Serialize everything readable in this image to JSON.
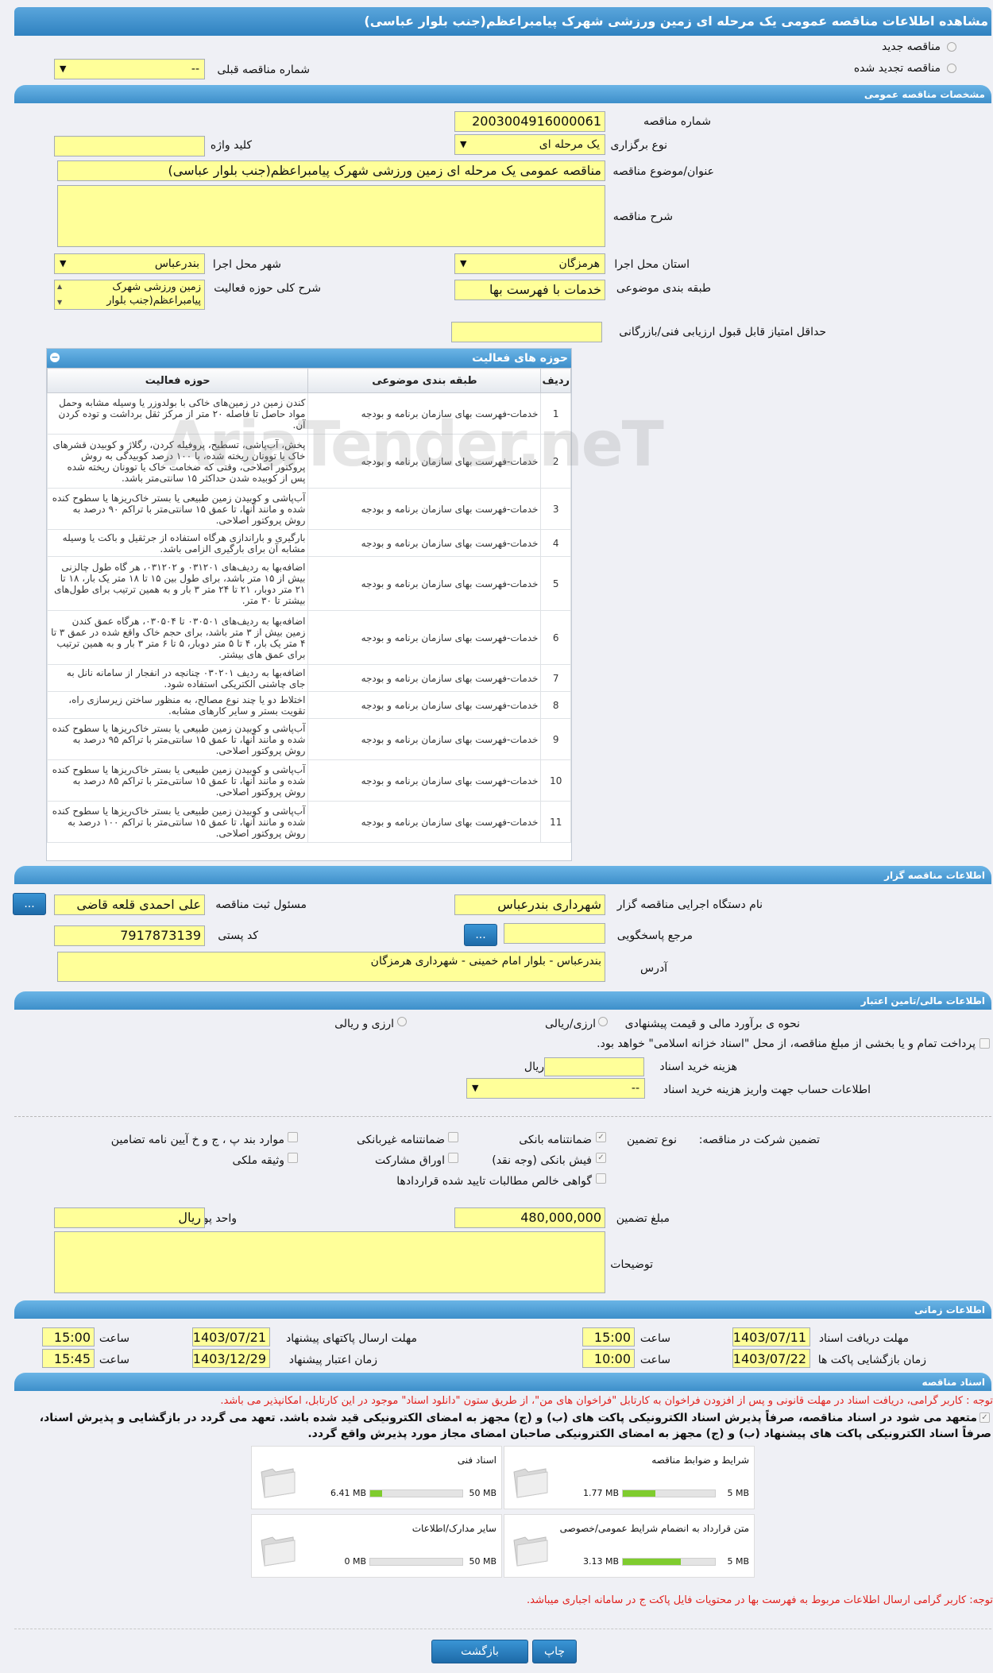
{
  "title": "مشاهده اطلاعات مناقصه عمومی یک مرحله ای زمین ورزشی شهرک پیامبراعظم(جنب بلوار عباسی)",
  "top": {
    "radio_new": "مناقصه جدید",
    "radio_renew": "مناقصه تجدید شده",
    "prev_label": "شماره مناقصه قبلی",
    "prev_value": "--"
  },
  "sections": {
    "general": "مشخصات مناقصه عمومی",
    "organizer": "اطلاعات مناقصه گزار",
    "financial": "اطلاعات مالی/تامین اعتبار",
    "timing": "اطلاعات زمانی",
    "docs": "اسناد مناقصه"
  },
  "general": {
    "number_label": "شماره مناقصه",
    "number_value": "2003004916000061",
    "type_label": "نوع برگزاری",
    "type_value": "یک مرحله ای",
    "keyword_label": "کلید واژه",
    "keyword_value": "",
    "subject_label": "عنوان/موضوع مناقصه",
    "subject_value": "مناقصه عمومی یک مرحله ای زمین ورزشی شهرک پیامبراعظم(جنب بلوار عباسی)",
    "desc_label": "شرح مناقصه",
    "desc_value": "",
    "province_label": "استان محل اجرا",
    "province_value": "هرمزگان",
    "city_label": "شهر محل اجرا",
    "city_value": "بندرعباس",
    "category_label": "طبقه بندی موضوعی",
    "category_value": "خدمات با فهرست بها",
    "scope_label": "شرح کلی حوزه فعالیت",
    "scope_value": "زمین ورزشی شهرک پیامبراعظم(جنب بلوار",
    "min_score_label": "حداقل امتیاز قابل قبول ارزیابی فنی/بازرگانی",
    "min_score_value": ""
  },
  "activities": {
    "title": "حوزه های فعالیت",
    "headers": [
      "ردیف",
      "طبقه بندی موضوعی",
      "حوزه فعالیت"
    ],
    "rows": [
      {
        "n": "1",
        "cat": "خدمات-فهرست بهای سازمان برنامه و بودجه",
        "desc": "کندن زمین در زمین‌های خاکی با بولدوزر یا وسیله مشابه وحمل مواد حاصل تا فاصله ۲۰ متر از مرکز ثقل برداشت و توده کردن آن."
      },
      {
        "n": "2",
        "cat": "خدمات-فهرست بهای سازمان برنامه و بودجه",
        "desc": "پخش، آب‌پاشی، تسطیح، پروفیله کردن، رگلاژ و کوبیدن قشرهای خاک یا توونان ریخته شده، با ۱۰۰ درصد کوبیدگی به روش پروکتور اصلاحی، وقتی که ضخامت خاک یا توونان ریخته شده پس از کوبیده شدن حداکثر ۱۵ سانتی‌متر باشد."
      },
      {
        "n": "3",
        "cat": "خدمات-فهرست بهای سازمان برنامه و بودجه",
        "desc": "آب‌پاشی و کوبیدن زمین طبیعی یا بستر خاک‌ریزها یا سطوح کنده شده و مانند آنها، تا عمق ۱۵ سانتی‌متر با تراکم ۹۰ درصد به روش پروکتور اصلاحی."
      },
      {
        "n": "4",
        "cat": "خدمات-فهرست بهای سازمان برنامه و بودجه",
        "desc": "بارگیری و باراندازی هرگاه استفاده از جرثقیل و باکت یا وسیله مشابه آن برای بارگیری الزامی باشد."
      },
      {
        "n": "5",
        "cat": "خدمات-فهرست بهای سازمان برنامه و بودجه",
        "desc": "اضافه‌بها به ردیف‌های ۰۳۱۲۰۱ و ۰۳۱۲۰۲، هر گاه طول چالزنی بیش از ۱۵ متر باشد، برای طول بین ۱۵ تا ۱۸ متر یک بار، ۱۸ تا ۲۱ متر دوبار، ۲۱ تا ۲۴ متر ۳ بار و به همین ترتیب برای طول‌های بیشتر تا ۳۰ متر."
      },
      {
        "n": "6",
        "cat": "خدمات-فهرست بهای سازمان برنامه و بودجه",
        "desc": "اضافه‌بها به ردیف‌های ۰۳۰۵۰۱ تا ۰۳۰۵۰۴، هرگاه عمق کندن زمین بیش از ۳ متر باشد، برای حجم خاک واقع شده در عمق ۳ تا ۴ متر یک بار، ۴ تا ۵ متر دوبار، ۵ تا ۶ متر ۳ بار و به همین ترتیب برای عمق های بیشتر."
      },
      {
        "n": "7",
        "cat": "خدمات-فهرست بهای سازمان برنامه و بودجه",
        "desc": "اضافه‌بها به ردیف ۰۳۰۲۰۱ چنانچه در انفجار از سامانه نانل به جای چاشنی الکتریکی استفاده شود."
      },
      {
        "n": "8",
        "cat": "خدمات-فهرست بهای سازمان برنامه و بودجه",
        "desc": "اختلاط دو یا چند نوع مصالح، به منظور ساختن زیرسازی راه، تقویت بستر و سایر کارهای مشابه."
      },
      {
        "n": "9",
        "cat": "خدمات-فهرست بهای سازمان برنامه و بودجه",
        "desc": "آب‌پاشی و کوبیدن زمین طبیعی یا بستر خاک‌ریزها یا سطوح کنده شده و مانند آنها، تا عمق ۱۵ سانتی‌متر با تراکم ۹۵ درصد به روش پروکتور اصلاحی."
      },
      {
        "n": "10",
        "cat": "خدمات-فهرست بهای سازمان برنامه و بودجه",
        "desc": "آب‌پاشی و کوبیدن زمین طبیعی یا بستر خاک‌ریزها یا سطوح کنده شده و مانند آنها، تا عمق ۱۵ سانتی‌متر با تراکم ۸۵ درصد به روش پروکتور اصلاحی."
      },
      {
        "n": "11",
        "cat": "خدمات-فهرست بهای سازمان برنامه و بودجه",
        "desc": "آب‌پاشی و کوبیدن زمین طبیعی یا بستر خاک‌ریزها یا سطوح کنده شده و مانند آنها، تا عمق ۱۵ سانتی‌متر با تراکم ۱۰۰ درصد به روش پروکتور اصلاحی."
      }
    ]
  },
  "organizer": {
    "org_label": "نام دستگاه اجرایی مناقصه گزار",
    "org_value": "شهرداری بندرعباس",
    "resp_label": "مسئول ثبت مناقصه",
    "resp_value": "علی احمدی قلعه قاضی",
    "ref_label": "مرجع پاسخگویی",
    "ref_value": "",
    "postal_label": "کد پستی",
    "postal_value": "7917873139",
    "address_label": "آدرس",
    "address_value": "بندرعباس - بلوار امام خمینی - شهرداری هرمزگان",
    "dots": "..."
  },
  "financial": {
    "estimate_label": "نحوه ی برآورد مالی و قیمت پیشنهادی",
    "opt1": "ارزی/ریالی",
    "opt2": "ارزی و ریالی",
    "treasury_text": "پرداخت تمام و یا بخشی از مبلغ مناقصه، از محل \"اسناد خزانه اسلامی\" خواهد بود.",
    "doc_cost_label": "هزینه خرید اسناد",
    "doc_cost_value": "",
    "doc_cost_unit": "ریال",
    "account_label": "اطلاعات حساب جهت واریز هزینه خرید اسناد",
    "account_value": "--",
    "guarantee_label": "تضمین شرکت در مناقصه:",
    "guarantee_type_label": "نوع تضمین",
    "g_bank": "ضمانتنامه بانکی",
    "g_nonbank": "ضمانتنامه غیربانکی",
    "g_items": "موارد بند پ ، ج و خ آیین نامه تضامین",
    "g_cash": "فیش بانکی (وجه نقد)",
    "g_bonds": "اوراق مشارکت",
    "g_property": "وثیقه ملکی",
    "g_claims": "گواهی خالص مطالبات تایید شده قراردادها",
    "amount_label": "مبلغ تضمین",
    "amount_value": "480,000,000",
    "currency_label": "واحد پول",
    "currency_value": "ریال",
    "notes_label": "توضیحات",
    "notes_value": ""
  },
  "timing": {
    "receive_label": "مهلت دریافت اسناد",
    "receive_date": "1403/07/11",
    "receive_time": "15:00",
    "send_label": "مهلت ارسال پاکتهای پیشنهاد",
    "send_date": "1403/07/21",
    "send_time": "15:00",
    "open_label": "زمان بازگشایی پاکت ها",
    "open_date": "1403/07/22",
    "open_time": "10:00",
    "valid_label": "زمان اعتبار پیشنهاد",
    "valid_date": "1403/12/29",
    "valid_time": "15:45",
    "time_label": "ساعت"
  },
  "docs": {
    "notice1": "توجه : کاربر گرامی، دریافت اسناد در مهلت قانونی و پس از افزودن فراخوان به کارتابل \"فراخوان های من\"، از طریق ستون \"دانلود اسناد\" موجود در این کارتابل، امکانپذیر می باشد.",
    "commit1": "متعهد می شود در اسناد مناقصه، صرفاً پذیرش اسناد الکترونیکی پاکت های (ب) و (ج) مجهز به امضای الکترونیکی قید شده باشد. تعهد می گردد در بازگشایی و پذیرش اسناد،",
    "commit2": "صرفاً اسناد الکترونیکی پاکت های پیشنهاد (ب) و (ج) مجهز به امضای الکترونیکی صاحبان امضای مجاز مورد پذیرش واقع گردد.",
    "cards": [
      {
        "title": "شرایط و ضوابط مناقصه",
        "used": "1.77 MB",
        "max": "5 MB",
        "frac": 0.35
      },
      {
        "title": "اسناد فنی",
        "used": "6.41 MB",
        "max": "50 MB",
        "frac": 0.13
      },
      {
        "title": "متن قرارداد به انضمام شرایط عمومی/خصوصی",
        "used": "3.13 MB",
        "max": "5 MB",
        "frac": 0.63
      },
      {
        "title": "سایر مدارک/اطلاعات",
        "used": "0 MB",
        "max": "50 MB",
        "frac": 0.0
      }
    ],
    "notice2": "توجه: کاربر گرامی ارسال اطلاعات مربوط به فهرست بها در محتویات فایل پاکت ج در سامانه اجباری میباشد."
  },
  "footer": {
    "print": "چاپ",
    "back": "بازگشت"
  },
  "watermark": "AriaTender.neT",
  "colors": {
    "accent": "#2f82c0",
    "field": "#ffff99",
    "warning": "#e0201c"
  }
}
